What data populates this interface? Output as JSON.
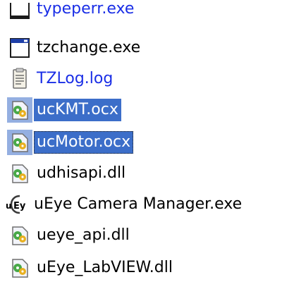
{
  "colors": {
    "selection": "#3c6ec9",
    "compressed_text": "#1a2ee6",
    "text": "#000000"
  },
  "files": [
    {
      "name": "typeperr.exe",
      "icon": "window-exe-icon",
      "color": "blue",
      "selected": false
    },
    {
      "name": "tzchange.exe",
      "icon": "window-exe-icon",
      "color": "black",
      "selected": false
    },
    {
      "name": "TZLog.log",
      "icon": "text-document-icon",
      "color": "blue",
      "selected": false
    },
    {
      "name": "ucKMT.ocx",
      "icon": "gear-dll-icon",
      "color": "black",
      "selected": true
    },
    {
      "name": "ucMotor.ocx",
      "icon": "gear-dll-icon",
      "color": "black",
      "selected": true,
      "focused": true
    },
    {
      "name": "udhisapi.dll",
      "icon": "gear-dll-icon",
      "color": "black",
      "selected": false
    },
    {
      "name": "uEye Camera Manager.exe",
      "icon": "ueye-app-icon",
      "color": "black",
      "selected": false
    },
    {
      "name": "ueye_api.dll",
      "icon": "gear-dll-icon",
      "color": "black",
      "selected": false
    },
    {
      "name": "uEye_LabVIEW.dll",
      "icon": "gear-dll-icon",
      "color": "black",
      "selected": false
    }
  ]
}
